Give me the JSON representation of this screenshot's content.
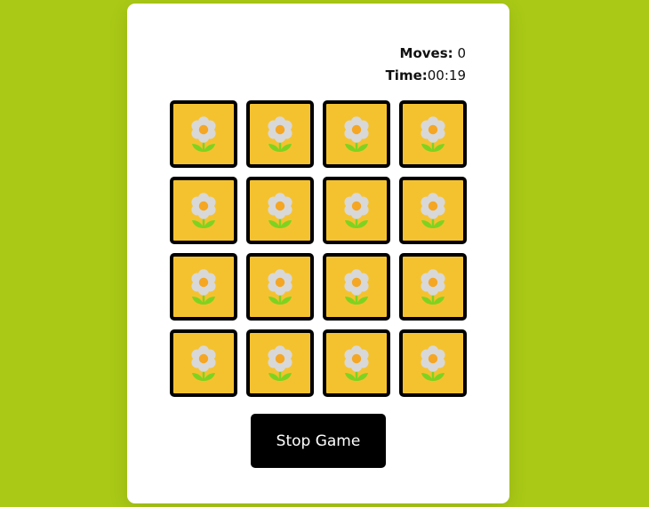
{
  "stats": {
    "moves_label": "Moves:",
    "moves_value": "0",
    "time_label": "Time:",
    "time_value": "00:19"
  },
  "cards": {
    "count": 16,
    "icon": "flower-icon",
    "colors": {
      "card_bg": "#f5c22f",
      "petal": "#d8d8d8",
      "center": "#f5a623",
      "stem": "#7ed321"
    }
  },
  "controls": {
    "stop_label": "Stop Game"
  },
  "theme": {
    "background": "#a9c916",
    "panel": "#ffffff",
    "button": "#000000"
  }
}
